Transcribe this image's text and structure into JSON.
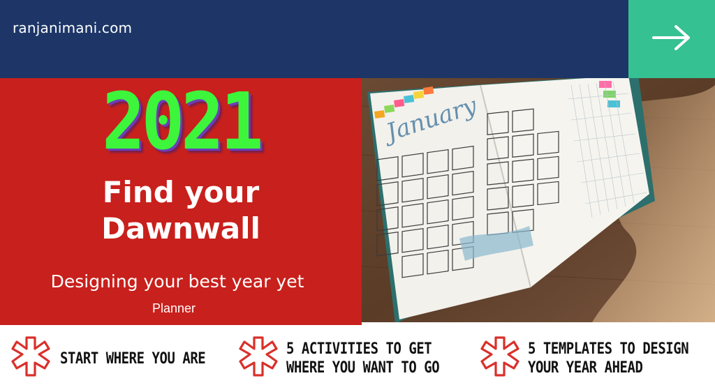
{
  "header": {
    "site_name": "ranjanimani.com",
    "next_icon": "arrow-right-icon",
    "accent_color": "#35c191",
    "bar_color": "#1d3667"
  },
  "hero": {
    "year": "2021",
    "headline_line1": "Find your",
    "headline_line2": "Dawnwall",
    "subtitle": "Designing your best year yet",
    "tag": "Planner",
    "background_color": "#c8201c",
    "year_color": "#3df53a"
  },
  "photo": {
    "subject": "open bullet journal with January calendar spread",
    "calendar_heading": "January"
  },
  "features": [
    {
      "icon": "asterisk-icon",
      "line1": "START WHERE YOU ARE",
      "line2": ""
    },
    {
      "icon": "asterisk-icon",
      "line1": "5 ACTIVITIES TO GET",
      "line2": "WHERE YOU WANT TO GO"
    },
    {
      "icon": "asterisk-icon",
      "line1": "5 TEMPLATES TO DESIGN",
      "line2": "YOUR YEAR AHEAD"
    }
  ]
}
